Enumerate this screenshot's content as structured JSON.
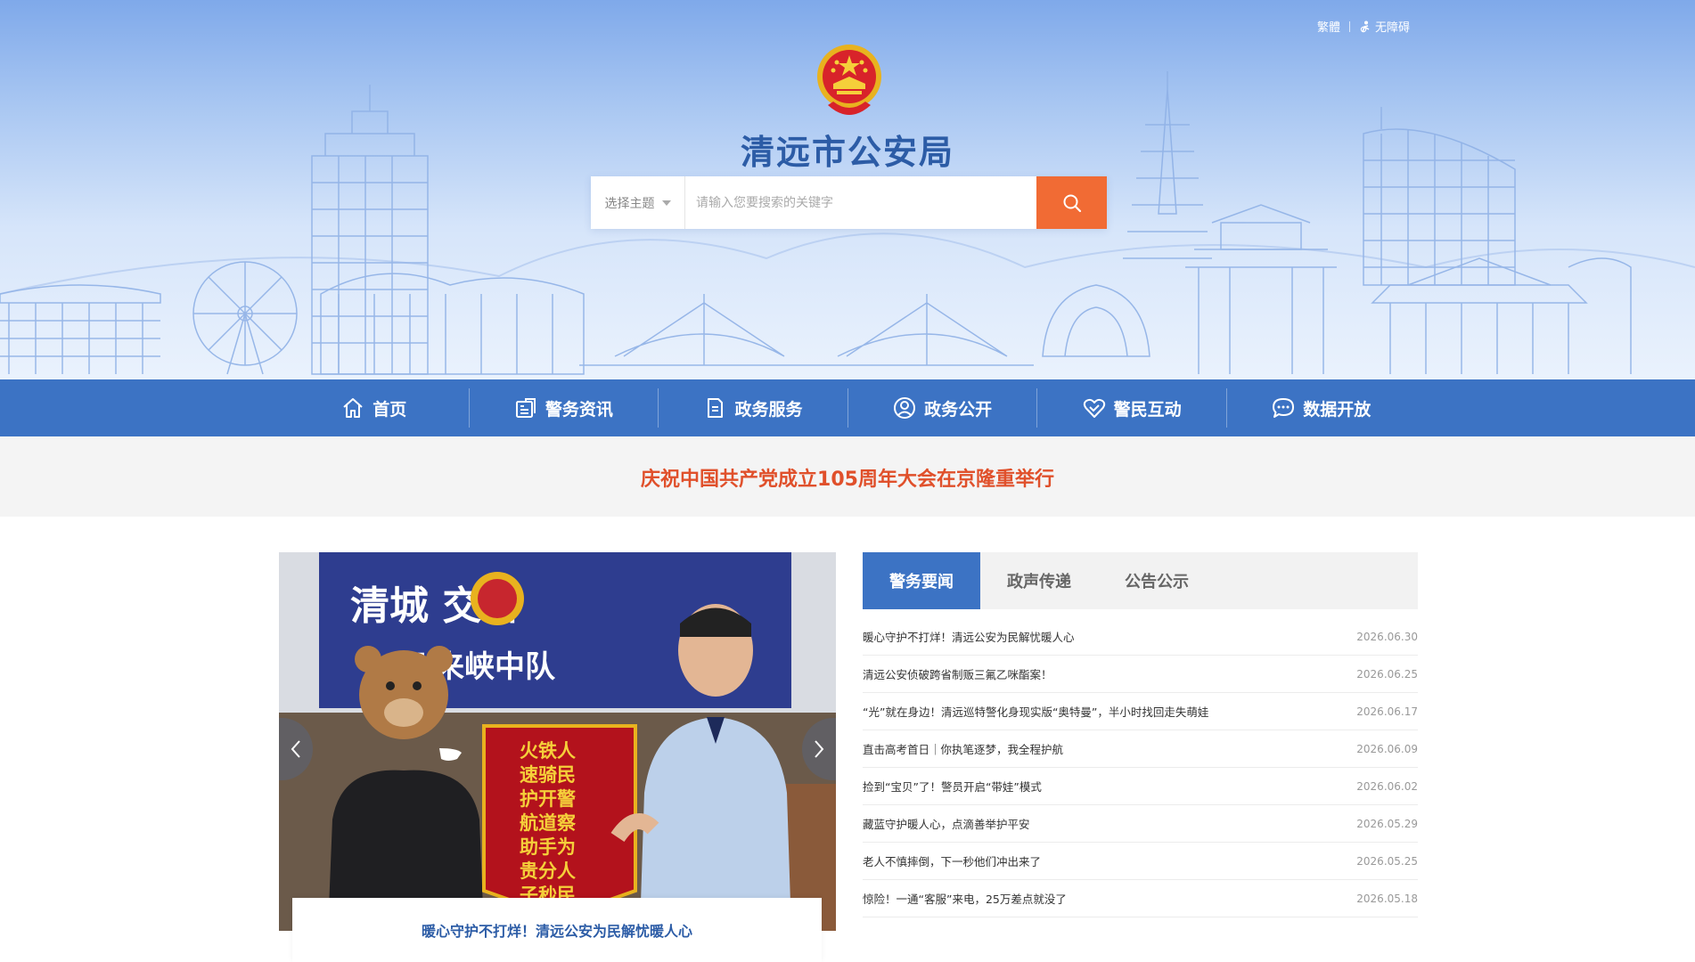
{
  "top_links": {
    "traditional": "繁體",
    "accessibility": "无障碍"
  },
  "site_title": "清远市公安局",
  "search": {
    "topic_label": "选择主题",
    "placeholder": "请输入您要搜索的关键字",
    "button_icon": "search-icon"
  },
  "nav": {
    "items": [
      {
        "label": "首页",
        "icon": "home-icon"
      },
      {
        "label": "警务资讯",
        "icon": "news-icon"
      },
      {
        "label": "政务服务",
        "icon": "document-icon"
      },
      {
        "label": "政务公开",
        "icon": "user-icon"
      },
      {
        "label": "警民互动",
        "icon": "heart-icon"
      },
      {
        "label": "数据开放",
        "icon": "chat-icon"
      }
    ]
  },
  "headline": "庆祝中国共产党成立105周年大会在京隆重举行",
  "carousel": {
    "caption": "暖心守护不打烊！清远公安为民解忧暖人心",
    "sign_title": "清城  交警",
    "sign_subtitle": "飞来峡中队",
    "banner_left": "火铁人 速骑民 护开警 航道察 助手为 贵分人 子秒民",
    "colors": {
      "sign": "#2e3d8f",
      "banner": "#b3121c",
      "uniform": "#bcd0ea"
    }
  },
  "news": {
    "tabs": [
      "警务要闻",
      "政声传递",
      "公告公示"
    ],
    "active_tab": 0,
    "items": [
      {
        "title": "暖心守护不打烊！清远公安为民解忧暖人心",
        "date": "2026.06.30"
      },
      {
        "title": "清远公安侦破跨省制贩三氟乙咪酯案！",
        "date": "2026.06.25"
      },
      {
        "title": "“光”就在身边！清远巡特警化身现实版“奥特曼”，半小时找回走失萌娃",
        "date": "2026.06.17"
      },
      {
        "title": "直击高考首日｜你执笔逐梦，我全程护航",
        "date": "2026.06.09"
      },
      {
        "title": "捡到“宝贝”了！警员开启“带娃”模式",
        "date": "2026.06.02"
      },
      {
        "title": "藏蓝守护暖人心，点滴善举护平安",
        "date": "2026.05.29"
      },
      {
        "title": "老人不慎摔倒，下一秒他们冲出来了",
        "date": "2026.05.25"
      },
      {
        "title": "惊险！一通“客服”来电，25万差点就没了",
        "date": "2026.05.18"
      }
    ]
  },
  "colors": {
    "primary": "#3c73c4",
    "accent": "#f16b34",
    "headline": "#e0502b",
    "title": "#2c5ca6"
  }
}
